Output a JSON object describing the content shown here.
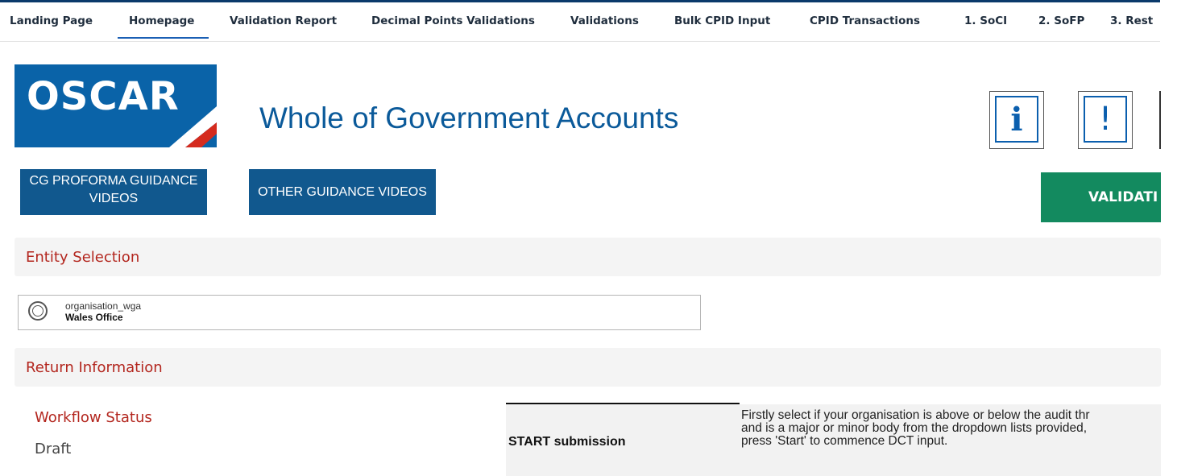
{
  "tabs": [
    {
      "label": "Landing Page",
      "active": false
    },
    {
      "label": "Homepage",
      "active": true
    },
    {
      "label": "Validation Report",
      "active": false
    },
    {
      "label": "Decimal Points Validations",
      "active": false
    },
    {
      "label": "Validations",
      "active": false
    },
    {
      "label": "Bulk CPID Input",
      "active": false
    },
    {
      "label": "CPID Transactions",
      "active": false
    },
    {
      "label": "1. SoCI",
      "active": false
    },
    {
      "label": "2. SoFP",
      "active": false
    },
    {
      "label": "3. Rest",
      "active": false
    }
  ],
  "header": {
    "logo_text": "OSCAR",
    "title": "Whole of Government Accounts",
    "info_icon": "info-icon",
    "alert_icon": "exclamation-icon"
  },
  "guidance": {
    "cg_videos_line1": "CG PROFORMA GUIDANCE",
    "cg_videos_line2": "VIDEOS",
    "other_videos": "OTHER GUIDANCE VIDEOS",
    "validate": "VALIDATI"
  },
  "entity_section": {
    "title": "Entity Selection",
    "field_label": "organisation_wga",
    "value": "Wales Office"
  },
  "return_section": {
    "title": "Return Information"
  },
  "workflow": {
    "label": "Workflow Status",
    "value": "Draft"
  },
  "start": {
    "label": "START submission",
    "description_lines": [
      "Firstly select if your organisation is above or below the audit thr",
      "and is a major or minor body from the dropdown lists provided,",
      "press 'Start' to commence DCT input."
    ]
  },
  "colors": {
    "brand_blue": "#0a63a8",
    "button_blue": "#11588e",
    "validate_green": "#138a5f",
    "section_red": "#b3261e"
  }
}
